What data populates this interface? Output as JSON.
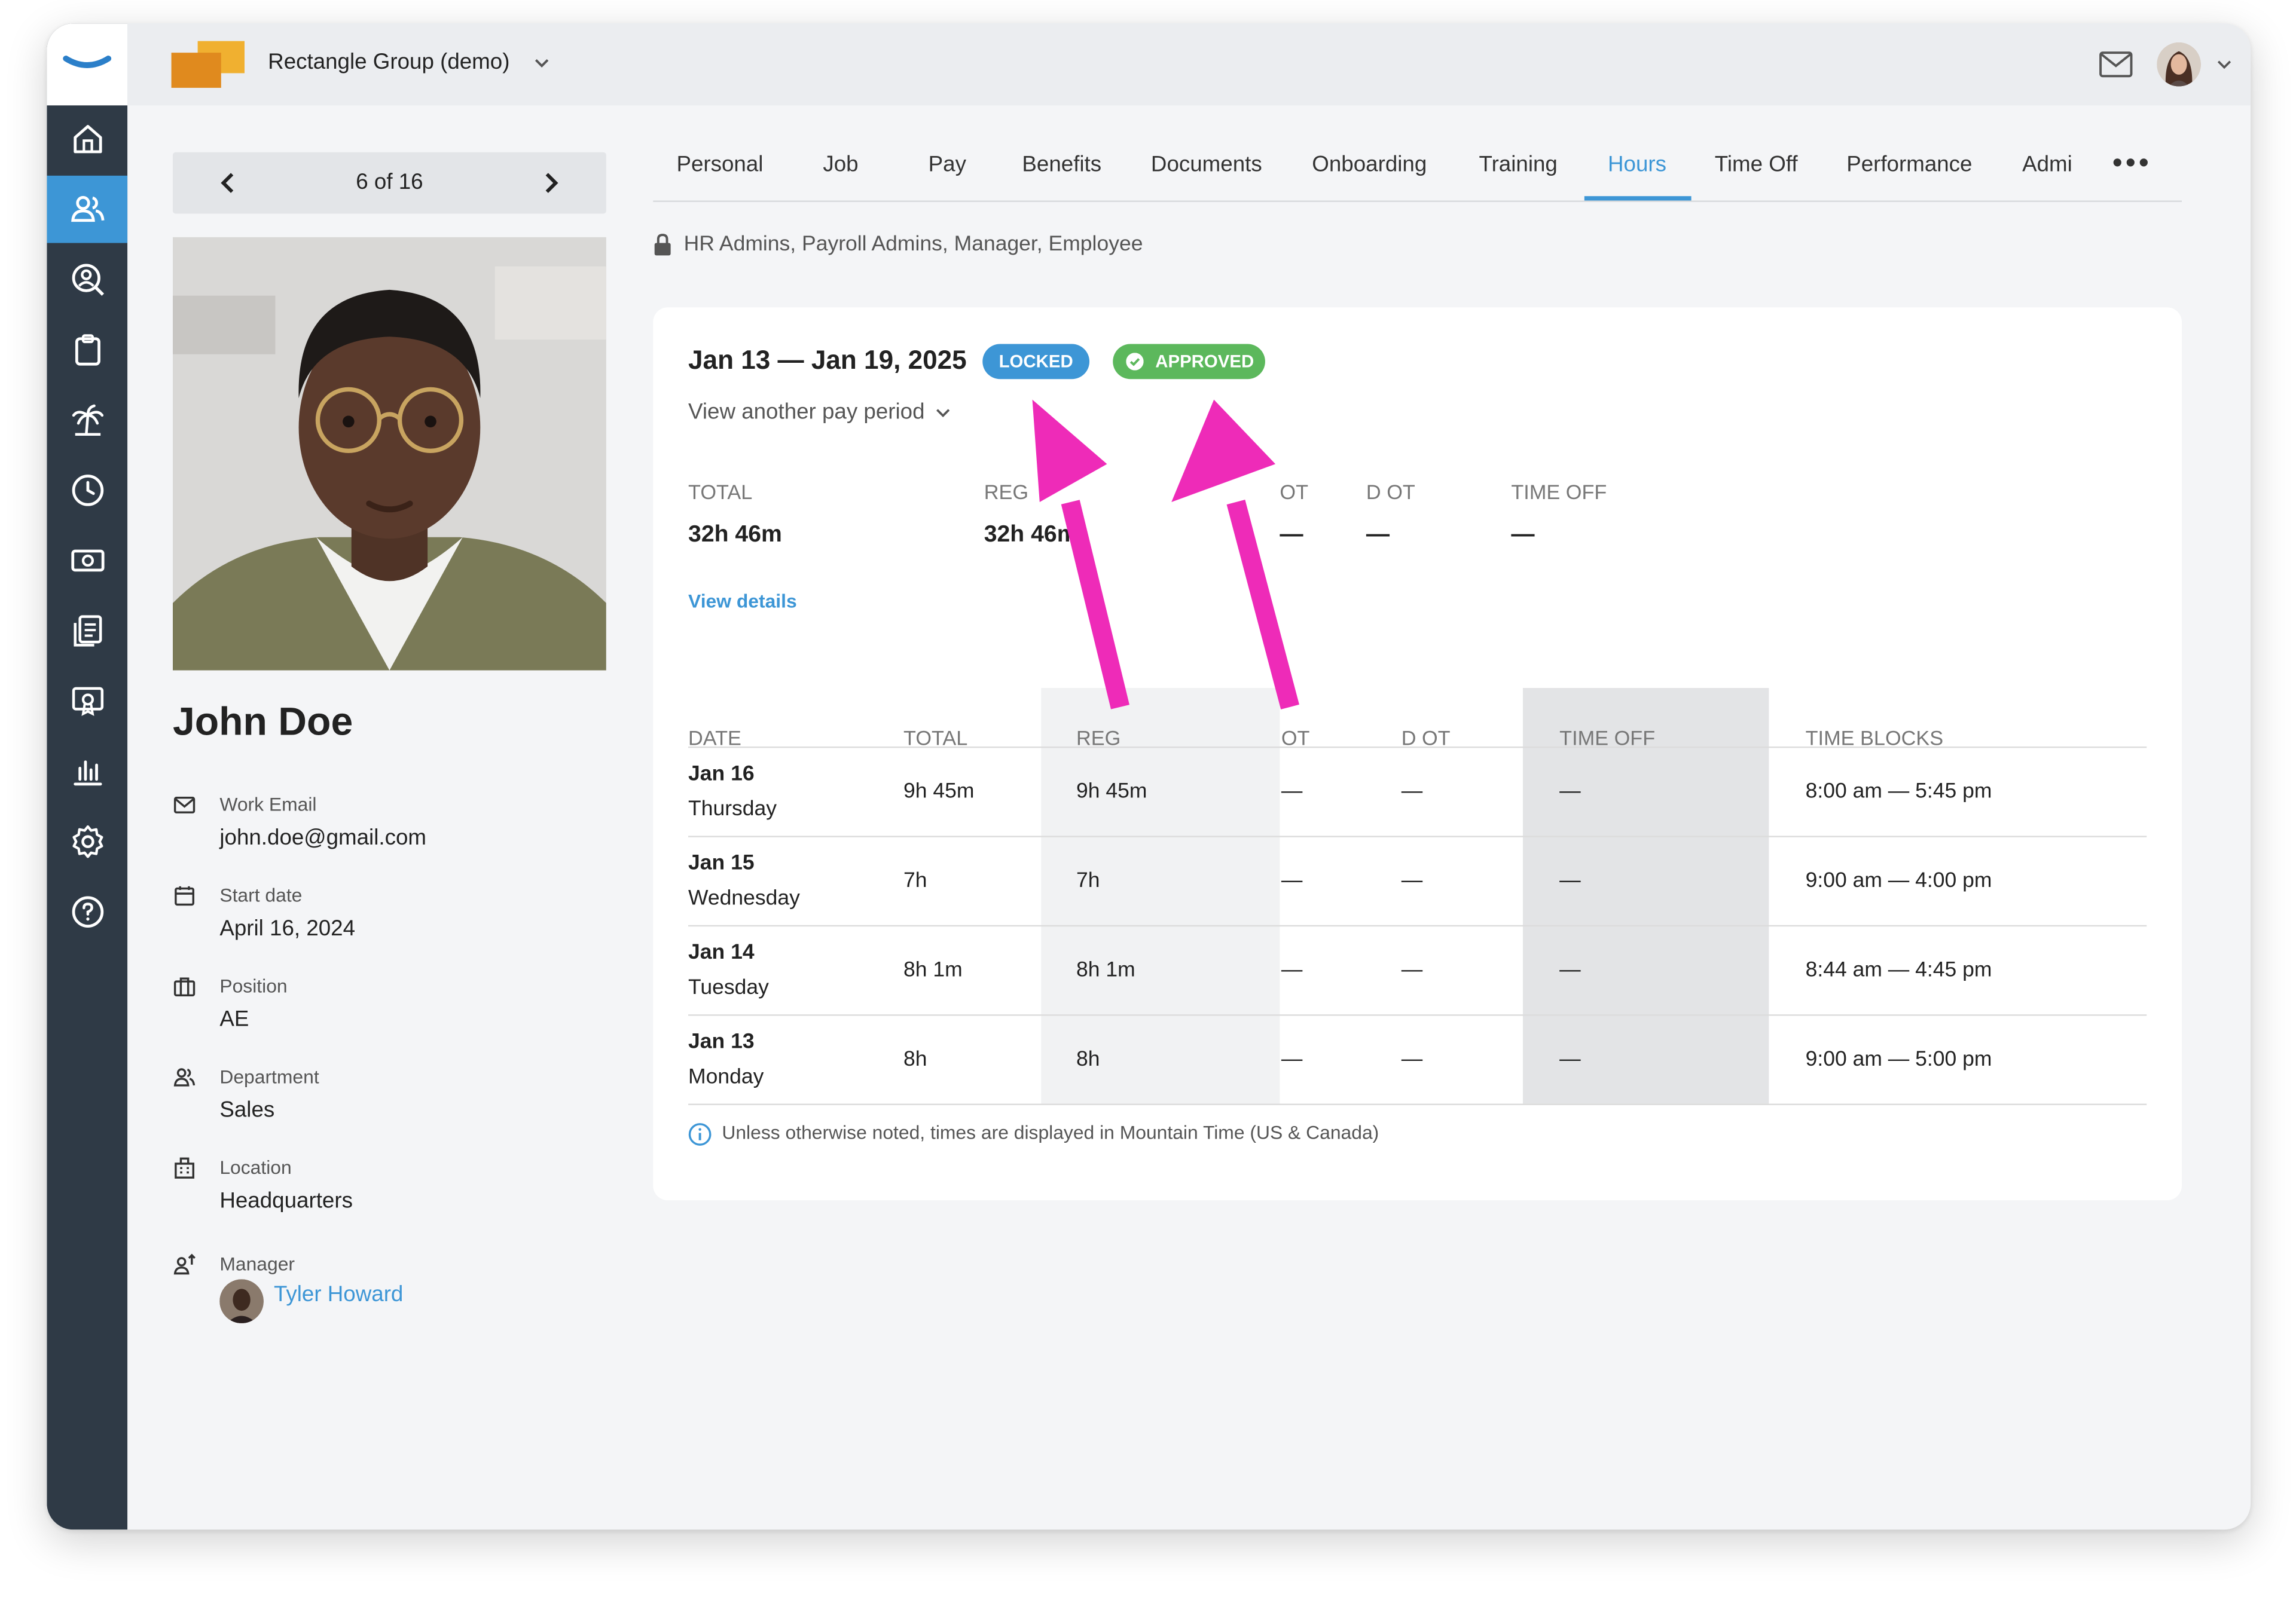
{
  "topbar": {
    "company": "Rectangle Group (demo)"
  },
  "pager": {
    "count": "6 of 16"
  },
  "employee": {
    "name": "John Doe",
    "fields": [
      {
        "label": "Work Email",
        "value": "john.doe@gmail.com"
      },
      {
        "label": "Start date",
        "value": "April 16, 2024"
      },
      {
        "label": "Position",
        "value": "AE"
      },
      {
        "label": "Department",
        "value": "Sales"
      },
      {
        "label": "Location",
        "value": "Headquarters"
      },
      {
        "label": "Manager",
        "value": "Tyler Howard"
      }
    ]
  },
  "tabs": [
    "Personal",
    "Job",
    "Pay",
    "Benefits",
    "Documents",
    "Onboarding",
    "Training",
    "Hours",
    "Time Off",
    "Performance",
    "Admi"
  ],
  "active_tab": "Hours",
  "access": "HR Admins, Payroll Admins, Manager, Employee",
  "hours": {
    "period": "Jan 13 — Jan 19, 2025",
    "badges": {
      "locked": "LOCKED",
      "approved": "APPROVED"
    },
    "another_period": "View another pay period",
    "summary": [
      {
        "label": "TOTAL",
        "value": "32h 46m"
      },
      {
        "label": "REG",
        "value": "32h 46m"
      },
      {
        "label": "OT",
        "value": "—"
      },
      {
        "label": "D OT",
        "value": "—"
      },
      {
        "label": "TIME OFF",
        "value": "—"
      }
    ],
    "view_details": "View details",
    "columns": [
      "DATE",
      "TOTAL",
      "REG",
      "OT",
      "D OT",
      "TIME OFF",
      "TIME BLOCKS"
    ],
    "rows": [
      {
        "date": "Jan 16",
        "day": "Thursday",
        "total": "9h 45m",
        "reg": "9h 45m",
        "ot": "—",
        "dot": "—",
        "timeoff": "—",
        "blocks": "8:00 am — 5:45 pm"
      },
      {
        "date": "Jan 15",
        "day": "Wednesday",
        "total": "7h",
        "reg": "7h",
        "ot": "—",
        "dot": "—",
        "timeoff": "—",
        "blocks": "9:00 am — 4:00 pm"
      },
      {
        "date": "Jan 14",
        "day": "Tuesday",
        "total": "8h 1m",
        "reg": "8h 1m",
        "ot": "—",
        "dot": "—",
        "timeoff": "—",
        "blocks": "8:44 am — 4:45 pm"
      },
      {
        "date": "Jan 13",
        "day": "Monday",
        "total": "8h",
        "reg": "8h",
        "ot": "—",
        "dot": "—",
        "timeoff": "—",
        "blocks": "9:00 am — 5:00 pm"
      }
    ],
    "note": "Unless otherwise noted, times are displayed in Mountain Time (US & Canada)"
  },
  "colors": {
    "accent": "#3d96d6",
    "sidebar": "#2f3a46",
    "approved": "#5cb85c",
    "annotation": "#ee2bb8"
  }
}
